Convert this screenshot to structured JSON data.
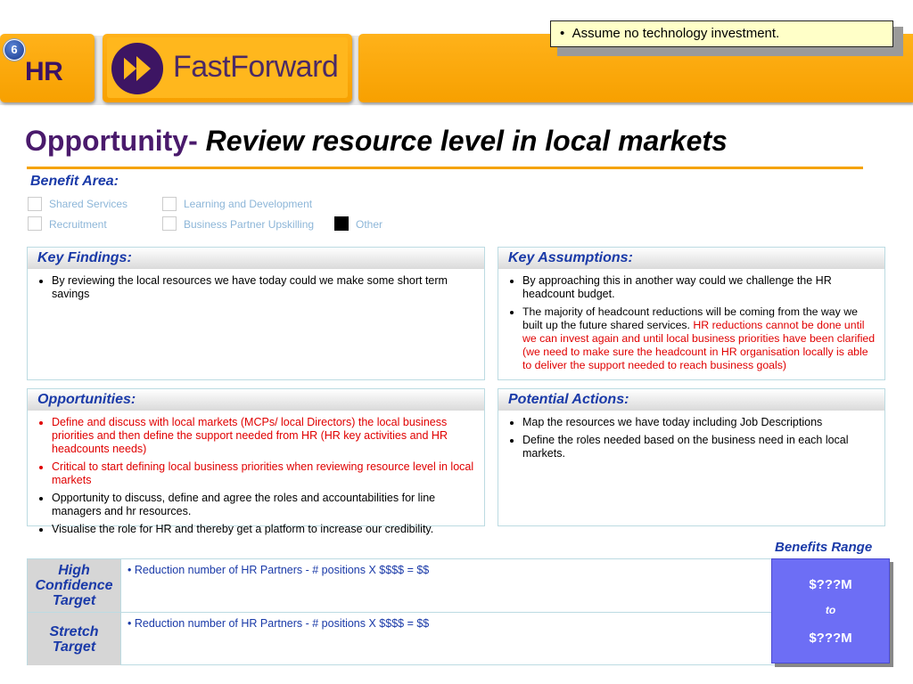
{
  "header": {
    "badge_number": "6",
    "section": "HR",
    "logo_text": "FastForward",
    "callout": "Assume no technology investment."
  },
  "title": {
    "prefix": "Opportunity- ",
    "main": "Review resource level in local markets"
  },
  "benefit_area": {
    "label": "Benefit Area:",
    "options": [
      {
        "label": "Shared Services",
        "checked": false
      },
      {
        "label": "Learning and Development",
        "checked": false
      },
      {
        "label": "Recruitment",
        "checked": false
      },
      {
        "label": "Business Partner Upskilling",
        "checked": false
      },
      {
        "label": "Other",
        "checked": true
      }
    ]
  },
  "key_findings": {
    "heading": "Key Findings:",
    "bullets": [
      "By reviewing the local resources we have today could we make some short term savings"
    ]
  },
  "key_assumptions": {
    "heading": "Key Assumptions:",
    "bullets": [
      "By approaching this in another way could we challenge the HR headcount budget.",
      "The majority of headcount reductions will be coming from the way we built up the future shared services. "
    ],
    "bullet2_red": "HR reductions cannot  be done until we can invest again and until local business priorities have been clarified (we need to make sure the headcount in HR organisation locally is able to deliver  the support needed to reach business goals)"
  },
  "opportunities": {
    "heading": "Opportunities:",
    "bullets": [
      "Define and discuss with local markets (MCPs/ local Directors) the local business priorities and  then define the support needed from HR (HR key activities and HR headcounts needs)",
      "Critical to start defining local business priorities when reviewing resource level in local markets",
      "Opportunity to discuss, define and agree the roles and accountabilities for line managers and hr resources.",
      "Visualise the role for HR and thereby get a platform to increase our credibility."
    ]
  },
  "potential_actions": {
    "heading": "Potential Actions:",
    "bullets": [
      "Map the resources we have today including Job Descriptions",
      "Define the roles needed based on the business need in each local markets."
    ]
  },
  "benefits": {
    "range_label": "Benefits Range",
    "high_label": "High Confidence Target",
    "high_text": "Reduction number of HR Partners - # positions X  $$$$ = $$",
    "stretch_label": "Stretch Target",
    "stretch_text": "Reduction number of HR Partners - # positions X  $$$$ = $$",
    "range_low": "$???M",
    "range_to": "to",
    "range_high": "$???M"
  },
  "colors": {
    "orange": "#f7a000",
    "purple": "#4a1a6c",
    "blue_heading": "#1a3aa8",
    "red_text": "#e00000",
    "range_box": "#6d6ef5"
  }
}
